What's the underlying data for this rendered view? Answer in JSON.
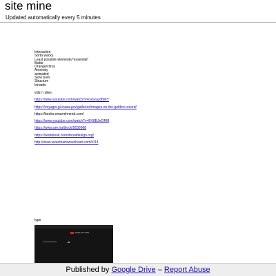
{
  "header": {
    "title": "site mine",
    "subtitle": "Updated automatically every 5 minutes"
  },
  "content": {
    "topics": [
      "Interaction",
      "Sorta wacky",
      "Least possible elements/\"essential\"",
      "Matte",
      "Orange/citrus",
      "Anomaly",
      "animated",
      "Slow burn",
      "Structure",
      "Innards"
    ],
    "links_heading": "vidz n sites:",
    "links": [
      "https://www.youtube.com/watch?v=nxGrazdtWIY",
      "https://voyager.jpl.nasa.gov/galleries/images-on-the-golden-record/",
      "https://books.omarmhmmd.com/",
      "https://www.youtube.com/watch?v=BV8BJrrDRM",
      "https://www.are.na/block/5639968",
      "https://workbook.com/donatdesign.org/",
      "http://www.sweethartsweetheart.com/#/14"
    ],
    "type_label": "type",
    "embed": {
      "brand": "SOM OTT PFE"
    }
  },
  "footer": {
    "prefix": "Published by",
    "drive_link": "Google Drive",
    "separator": "–",
    "abuse_link": "Report Abuse"
  },
  "colors": {
    "link": "#1a0dab",
    "footer_bg": "#eeeeee",
    "embed_bg": "#141414",
    "embed_accent": "#e02020"
  }
}
